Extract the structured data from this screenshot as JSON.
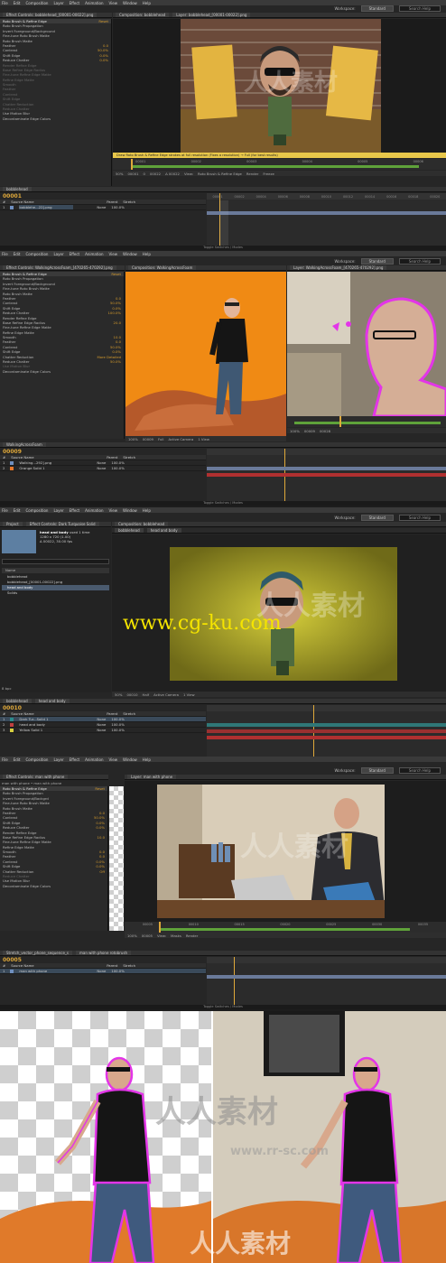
{
  "menu": [
    "File",
    "Edit",
    "Composition",
    "Layer",
    "Effect",
    "Animation",
    "View",
    "Window",
    "Help"
  ],
  "workspace": {
    "label": "Workspace:",
    "value": "Standard",
    "search": "Search Help"
  },
  "shot1": {
    "fx_tab": "Effect Controls: bobblehead_[00001-00022].png",
    "comp_tab": "Composition: bobblehead",
    "layer_tab": "Layer: bobblehead_[00001-00022].png",
    "fx_rows": [
      {
        "label": "Roto Brush & Refine Edge",
        "value": "Reset",
        "hdr": true
      },
      {
        "label": "Roto Brush Propagation",
        "value": ""
      },
      {
        "label": "Invert Foreground/Background",
        "value": ""
      },
      {
        "label": "Fine-tune Roto Brush Matte",
        "value": ""
      },
      {
        "label": "Roto Brush Matte",
        "value": ""
      },
      {
        "label": "Feather",
        "value": "0.0"
      },
      {
        "label": "Contrast",
        "value": "50.0%"
      },
      {
        "label": "Shift Edge",
        "value": "0.0%"
      },
      {
        "label": "Reduce Chatter",
        "value": "0.0%"
      },
      {
        "label": "Render Refine Edge",
        "value": "",
        "dim": true
      },
      {
        "label": "Base Refine Edge Radius",
        "value": "",
        "dim": true
      },
      {
        "label": "Fine-tune Refine Edge Matte",
        "value": "",
        "dim": true
      },
      {
        "label": "Refine Edge Matte",
        "value": "",
        "dim": true
      },
      {
        "label": "Smooth",
        "value": "",
        "dim": true
      },
      {
        "label": "Feather",
        "value": "",
        "dim": true
      },
      {
        "label": "Contrast",
        "value": "",
        "dim": true
      },
      {
        "label": "Shift Edge",
        "value": "",
        "dim": true
      },
      {
        "label": "Chatter Reduction",
        "value": "",
        "dim": true
      },
      {
        "label": "Reduce Chatter",
        "value": "",
        "dim": true
      },
      {
        "label": "Use Motion Blur",
        "value": ""
      },
      {
        "label": "Decontaminate Edge Colors",
        "value": ""
      }
    ],
    "status": "Draw Roto Brush & Refine Edge strokes at full resolution (Fixes a resolution) → Full (for best results)",
    "frames": [
      "00001",
      "00002",
      "00003",
      "00004",
      "00005",
      "00006"
    ],
    "viewer_bar": [
      "50%",
      "00001",
      "0",
      "00022",
      "Δ 00022",
      "View:",
      "Roto Brush & Refine Edge",
      "Render",
      "Freeze"
    ],
    "timeline_tab": "bobblehead",
    "timecode": "00001",
    "col_headers": [
      "#",
      "Source Name",
      "Parent",
      "Stretch"
    ],
    "layers": [
      {
        "num": "1",
        "name": "bobblehe...22].png",
        "parent": "None",
        "stretch": "100.0%"
      }
    ],
    "ruler": [
      "00001",
      "00002",
      "00004",
      "00006",
      "00008",
      "00010",
      "00012",
      "00014",
      "00016",
      "00018",
      "00020"
    ]
  },
  "toggle_label": "Toggle Switches / Modes",
  "shot2": {
    "fx_tab": "Effect Controls: WalkingAcrossFoam_[470265-470292].png",
    "comp_tab": "Composition: WalkingAcrossFoam",
    "layer_tab": "Layer: WalkingAcrossFoam_[470265-470292].png",
    "fx_rows": [
      {
        "label": "Roto Brush & Refine Edge",
        "value": "Reset",
        "hdr": true
      },
      {
        "label": "Roto Brush Propagation",
        "value": ""
      },
      {
        "label": "Invert Foreground/Background",
        "value": ""
      },
      {
        "label": "Fine-tune Roto Brush Matte",
        "value": ""
      },
      {
        "label": "Roto Brush Matte",
        "value": ""
      },
      {
        "label": "Feather",
        "value": "0.0"
      },
      {
        "label": "Contrast",
        "value": "50.0%"
      },
      {
        "label": "Shift Edge",
        "value": "0.0%"
      },
      {
        "label": "Reduce Chatter",
        "value": "100.0%"
      },
      {
        "label": "Render Refine Edge",
        "value": ""
      },
      {
        "label": "Base Refine Edge Radius",
        "value": "20.0"
      },
      {
        "label": "Fine-tune Refine Edge Matte",
        "value": ""
      },
      {
        "label": "Refine Edge Matte",
        "value": ""
      },
      {
        "label": "Smooth",
        "value": "10.0"
      },
      {
        "label": "Feather",
        "value": "0.0"
      },
      {
        "label": "Contrast",
        "value": "50.0%"
      },
      {
        "label": "Shift Edge",
        "value": "0.0%"
      },
      {
        "label": "Chatter Reduction",
        "value": "More Detailed"
      },
      {
        "label": "Reduce Chatter",
        "value": "50.0%"
      },
      {
        "label": "Use Motion Blur",
        "value": "",
        "dim": true
      },
      {
        "label": "Decontaminate Edge Colors",
        "value": ""
      }
    ],
    "viewer_bar": [
      "100%",
      "00009",
      "Full",
      "Active Camera",
      "1 View"
    ],
    "layer_bar": [
      "100%",
      "00009",
      "00028"
    ],
    "timeline_tab": "WalkingAcrossFoam",
    "timecode": "00009",
    "layers": [
      {
        "num": "1",
        "name": "Walking...292].png",
        "parent": "None",
        "stretch": "100.0%",
        "color": "#6f8fbf"
      },
      {
        "num": "2",
        "name": "Orange Solid 1",
        "parent": "None",
        "stretch": "100.0%",
        "color": "#e7782b"
      }
    ]
  },
  "shot3": {
    "project_tab": "Project",
    "fx_tab": "Effect Controls: Dark Turquoise Solid",
    "comp_tab": "Composition: bobblehead",
    "breadcrumb": [
      "bobblehead",
      "head and body"
    ],
    "project_item": {
      "name": "head and body",
      "used": "used 1 time",
      "dims": "1280 x 720 (1.00)",
      "dur": "Δ 00022, 30.00 fps"
    },
    "project_list_header": "Name",
    "project_items": [
      {
        "name": "bobblehead",
        "selected": false
      },
      {
        "name": "bobblehead_[00001-00022].png",
        "selected": false
      },
      {
        "name": "head and body",
        "selected": true
      },
      {
        "name": "Solids",
        "selected": false
      }
    ],
    "project_footer": "8 bpc",
    "viewer_bar": [
      "50%",
      "00010",
      "Half",
      "Active Camera",
      "1 View"
    ],
    "timeline_tabs": [
      "bobblehead",
      "head and body"
    ],
    "timecode": "00010",
    "layers": [
      {
        "num": "1",
        "name": "Dark Tur...Solid 1",
        "parent": "None",
        "stretch": "100.0%",
        "color": "#2a8c8c"
      },
      {
        "num": "2",
        "name": "head and body",
        "parent": "None",
        "stretch": "100.0%",
        "color": "#c04040"
      },
      {
        "num": "3",
        "name": "Yellow Solid 1",
        "parent": "None",
        "stretch": "100.0%",
        "color": "#d8d040"
      }
    ],
    "watermark_url": "www.cg-ku.com"
  },
  "shot4": {
    "fx_tab": "Effect Controls: man with phone",
    "breadcrumb": "man with phone • man with phone",
    "layer_tab": "Layer: man with phone",
    "fx_rows": [
      {
        "label": "Roto Brush & Refine Edge",
        "value": "Reset",
        "hdr": true
      },
      {
        "label": "Roto Brush Propagation",
        "value": ""
      },
      {
        "label": "Invert Foreground/Backgrd",
        "value": ""
      },
      {
        "label": "Fine-tune Roto Brush Matte",
        "value": ""
      },
      {
        "label": "Roto Brush Matte",
        "value": ""
      },
      {
        "label": "Feather",
        "value": "0.0"
      },
      {
        "label": "Contrast",
        "value": "50.0%"
      },
      {
        "label": "Shift Edge",
        "value": "0.0%"
      },
      {
        "label": "Reduce Chatter",
        "value": "0.0%"
      },
      {
        "label": "Render Refine Edge",
        "value": ""
      },
      {
        "label": "Base Refine Edge Radius",
        "value": "10.0"
      },
      {
        "label": "Fine-tune Refine Edge Matte",
        "value": ""
      },
      {
        "label": "Refine Edge Matte",
        "value": ""
      },
      {
        "label": "Smooth",
        "value": "0.0"
      },
      {
        "label": "Feather",
        "value": "0.0"
      },
      {
        "label": "Contrast",
        "value": "0.0%"
      },
      {
        "label": "Shift Edge",
        "value": "0.0%"
      },
      {
        "label": "Chatter Reduction",
        "value": "Off"
      },
      {
        "label": "Reduce Chatter",
        "value": "",
        "dim": true
      },
      {
        "label": "Use Motion Blur",
        "value": ""
      },
      {
        "label": "Decontaminate Edge Colors",
        "value": ""
      }
    ],
    "frames": [
      "00005",
      "00010",
      "00015",
      "00020",
      "00025",
      "00030",
      "00035"
    ],
    "layer_bar": [
      "100%",
      "00005",
      "View:",
      "Masks",
      "Render"
    ],
    "timeline_tabs": [
      "Stretch_vector_phone_sequence_s",
      "man with phone rotobrush"
    ],
    "timecode": "00005",
    "layers": [
      {
        "num": "1",
        "name": "man with phone",
        "parent": "None",
        "stretch": "100.0%",
        "color": "#6f8fbf"
      }
    ]
  },
  "watermark_cn": "人人素材",
  "watermark_sub": "www.rr-sc.com",
  "colors": {
    "accent": "#d69b2c",
    "roto_outline": "#e335e8",
    "panel": "#262626",
    "orange_bg": "#f08a14",
    "yellow_bg": "#b8b028",
    "url_yellow": "#f5e400"
  }
}
